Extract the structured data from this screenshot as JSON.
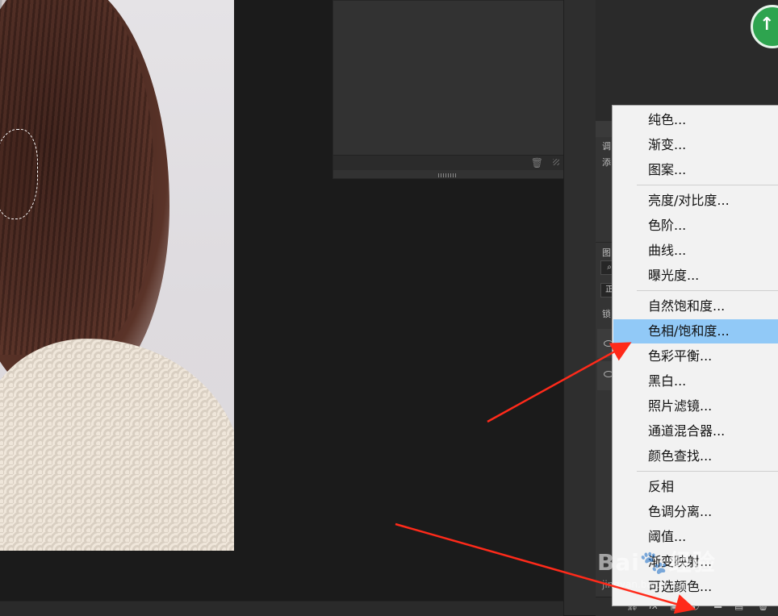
{
  "canvas": {
    "document_image": "portrait-photo"
  },
  "adjustment_panel": {
    "label_top": "调",
    "label_second": "添"
  },
  "layers_panel": {
    "label": "图",
    "search_icon": "search-icon",
    "mode_label": "正",
    "lock_label": "锁"
  },
  "adjustment_menu": {
    "groups": [
      [
        "纯色...",
        "渐变...",
        "图案..."
      ],
      [
        "亮度/对比度...",
        "色阶...",
        "曲线...",
        "曝光度..."
      ],
      [
        "自然饱和度...",
        "色相/饱和度...",
        "色彩平衡...",
        "黑白...",
        "照片滤镜...",
        "通道混合器...",
        "颜色查找..."
      ],
      [
        "反相",
        "色调分离...",
        "阈值...",
        "渐变映射...",
        "可选颜色..."
      ]
    ],
    "highlighted": "色相/饱和度...",
    "highlight_color": "#91c9f7"
  },
  "bottom_toolbar": {
    "icons": [
      "link-icon",
      "fx-icon",
      "mask-icon",
      "adjustment-layer-icon",
      "group-folder-icon",
      "new-layer-icon",
      "trash-icon"
    ],
    "fx_label": "fx"
  },
  "watermark": {
    "brand": "Bai",
    "brand2": "经验",
    "sub": "jingyan.baidu.com"
  },
  "annotation": {
    "arrow_color": "#ff2a1a"
  }
}
